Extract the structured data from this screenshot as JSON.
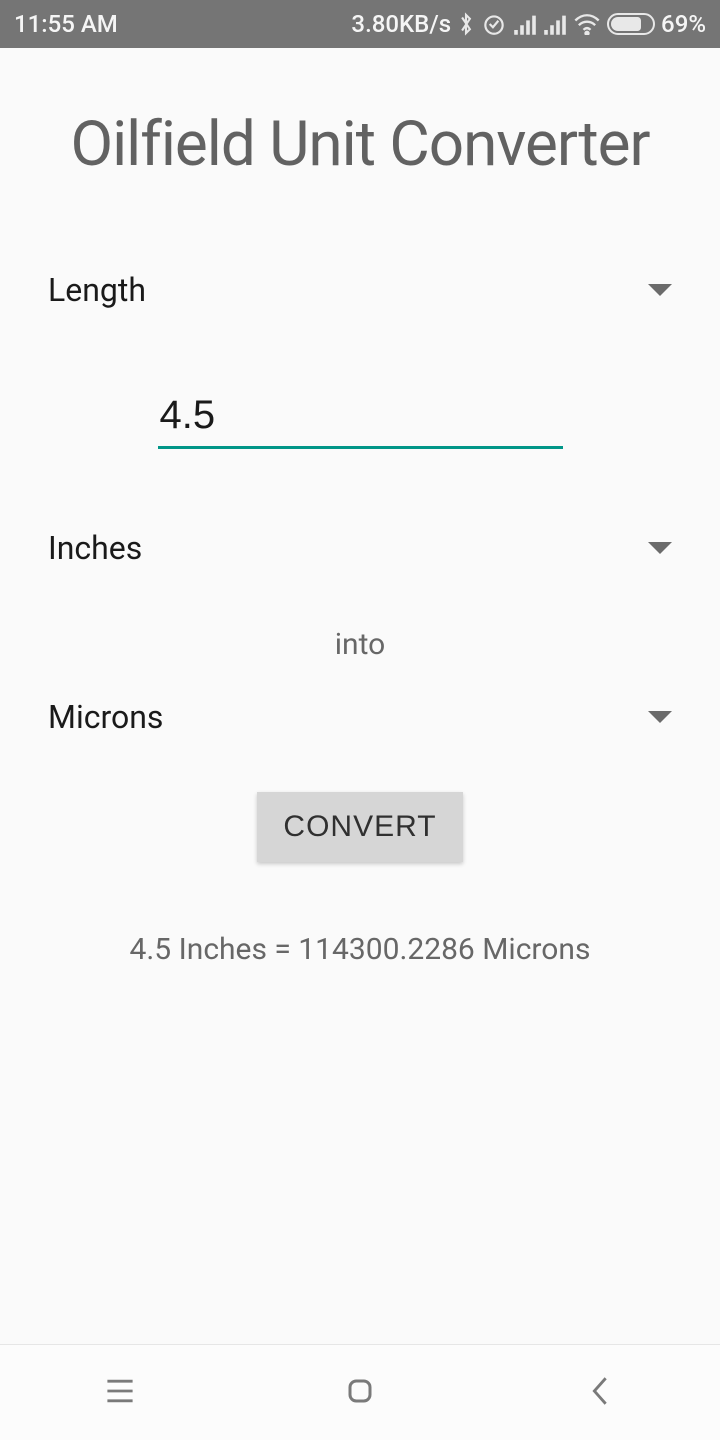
{
  "status": {
    "time": "11:55 AM",
    "net_speed": "3.80KB/s",
    "battery_pct": "69%"
  },
  "app": {
    "title": "Oilfield Unit Converter",
    "category": "Length",
    "value": "4.5",
    "from_unit": "Inches",
    "into_label": "into",
    "to_unit": "Microns",
    "convert_label": "CONVERT",
    "result_text": "4.5 Inches = 114300.2286 Microns"
  }
}
